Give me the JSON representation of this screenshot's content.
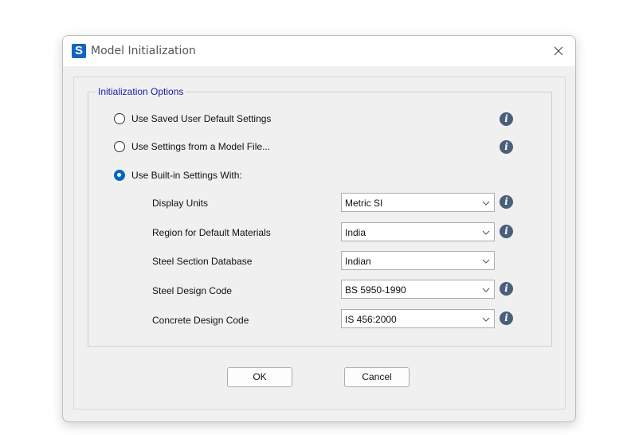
{
  "window": {
    "title": "Model Initialization",
    "app_icon_letter": "S"
  },
  "group": {
    "legend": "Initialization Options"
  },
  "options": [
    {
      "label": "Use Saved User Default Settings",
      "checked": false
    },
    {
      "label": "Use Settings from a Model File...",
      "checked": false
    },
    {
      "label": "Use Built-in Settings With:",
      "checked": true
    }
  ],
  "fields": [
    {
      "label": "Display Units",
      "value": "Metric SI",
      "info": true
    },
    {
      "label": "Region for Default Materials",
      "value": "India",
      "info": true
    },
    {
      "label": "Steel Section Database",
      "value": "Indian",
      "info": false
    },
    {
      "label": "Steel Design Code",
      "value": "BS 5950-1990",
      "info": true
    },
    {
      "label": "Concrete Design Code",
      "value": "IS 456:2000",
      "info": true
    }
  ],
  "buttons": {
    "ok": "OK",
    "cancel": "Cancel"
  },
  "icons": {
    "info": "info-icon",
    "close": "close-icon",
    "dropdown": "chevron-down-icon"
  },
  "colors": {
    "accent": "#0067c0",
    "legend_text": "#1a1aa6",
    "app_icon_bg": "#1565c0"
  }
}
